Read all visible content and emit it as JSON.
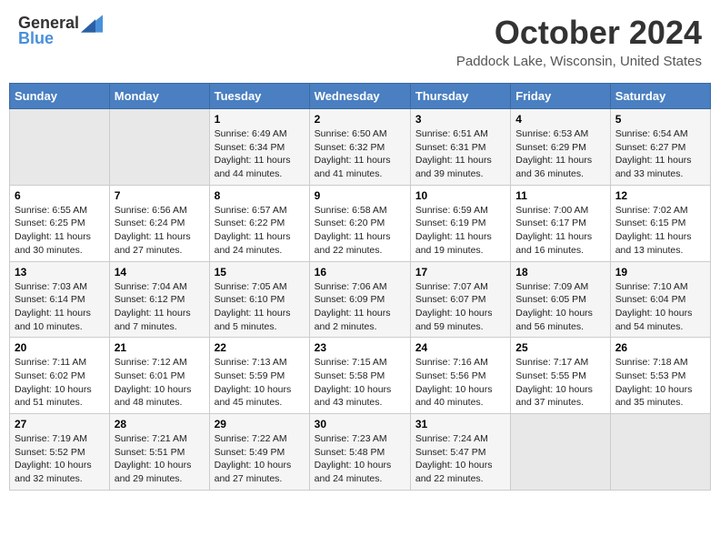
{
  "header": {
    "logo_general": "General",
    "logo_blue": "Blue",
    "month_title": "October 2024",
    "location": "Paddock Lake, Wisconsin, United States"
  },
  "days_of_week": [
    "Sunday",
    "Monday",
    "Tuesday",
    "Wednesday",
    "Thursday",
    "Friday",
    "Saturday"
  ],
  "weeks": [
    [
      {
        "day": "",
        "empty": true
      },
      {
        "day": "",
        "empty": true
      },
      {
        "day": "1",
        "sunrise": "6:49 AM",
        "sunset": "6:34 PM",
        "daylight": "11 hours and 44 minutes."
      },
      {
        "day": "2",
        "sunrise": "6:50 AM",
        "sunset": "6:32 PM",
        "daylight": "11 hours and 41 minutes."
      },
      {
        "day": "3",
        "sunrise": "6:51 AM",
        "sunset": "6:31 PM",
        "daylight": "11 hours and 39 minutes."
      },
      {
        "day": "4",
        "sunrise": "6:53 AM",
        "sunset": "6:29 PM",
        "daylight": "11 hours and 36 minutes."
      },
      {
        "day": "5",
        "sunrise": "6:54 AM",
        "sunset": "6:27 PM",
        "daylight": "11 hours and 33 minutes."
      }
    ],
    [
      {
        "day": "6",
        "sunrise": "6:55 AM",
        "sunset": "6:25 PM",
        "daylight": "11 hours and 30 minutes."
      },
      {
        "day": "7",
        "sunrise": "6:56 AM",
        "sunset": "6:24 PM",
        "daylight": "11 hours and 27 minutes."
      },
      {
        "day": "8",
        "sunrise": "6:57 AM",
        "sunset": "6:22 PM",
        "daylight": "11 hours and 24 minutes."
      },
      {
        "day": "9",
        "sunrise": "6:58 AM",
        "sunset": "6:20 PM",
        "daylight": "11 hours and 22 minutes."
      },
      {
        "day": "10",
        "sunrise": "6:59 AM",
        "sunset": "6:19 PM",
        "daylight": "11 hours and 19 minutes."
      },
      {
        "day": "11",
        "sunrise": "7:00 AM",
        "sunset": "6:17 PM",
        "daylight": "11 hours and 16 minutes."
      },
      {
        "day": "12",
        "sunrise": "7:02 AM",
        "sunset": "6:15 PM",
        "daylight": "11 hours and 13 minutes."
      }
    ],
    [
      {
        "day": "13",
        "sunrise": "7:03 AM",
        "sunset": "6:14 PM",
        "daylight": "11 hours and 10 minutes."
      },
      {
        "day": "14",
        "sunrise": "7:04 AM",
        "sunset": "6:12 PM",
        "daylight": "11 hours and 7 minutes."
      },
      {
        "day": "15",
        "sunrise": "7:05 AM",
        "sunset": "6:10 PM",
        "daylight": "11 hours and 5 minutes."
      },
      {
        "day": "16",
        "sunrise": "7:06 AM",
        "sunset": "6:09 PM",
        "daylight": "11 hours and 2 minutes."
      },
      {
        "day": "17",
        "sunrise": "7:07 AM",
        "sunset": "6:07 PM",
        "daylight": "10 hours and 59 minutes."
      },
      {
        "day": "18",
        "sunrise": "7:09 AM",
        "sunset": "6:05 PM",
        "daylight": "10 hours and 56 minutes."
      },
      {
        "day": "19",
        "sunrise": "7:10 AM",
        "sunset": "6:04 PM",
        "daylight": "10 hours and 54 minutes."
      }
    ],
    [
      {
        "day": "20",
        "sunrise": "7:11 AM",
        "sunset": "6:02 PM",
        "daylight": "10 hours and 51 minutes."
      },
      {
        "day": "21",
        "sunrise": "7:12 AM",
        "sunset": "6:01 PM",
        "daylight": "10 hours and 48 minutes."
      },
      {
        "day": "22",
        "sunrise": "7:13 AM",
        "sunset": "5:59 PM",
        "daylight": "10 hours and 45 minutes."
      },
      {
        "day": "23",
        "sunrise": "7:15 AM",
        "sunset": "5:58 PM",
        "daylight": "10 hours and 43 minutes."
      },
      {
        "day": "24",
        "sunrise": "7:16 AM",
        "sunset": "5:56 PM",
        "daylight": "10 hours and 40 minutes."
      },
      {
        "day": "25",
        "sunrise": "7:17 AM",
        "sunset": "5:55 PM",
        "daylight": "10 hours and 37 minutes."
      },
      {
        "day": "26",
        "sunrise": "7:18 AM",
        "sunset": "5:53 PM",
        "daylight": "10 hours and 35 minutes."
      }
    ],
    [
      {
        "day": "27",
        "sunrise": "7:19 AM",
        "sunset": "5:52 PM",
        "daylight": "10 hours and 32 minutes."
      },
      {
        "day": "28",
        "sunrise": "7:21 AM",
        "sunset": "5:51 PM",
        "daylight": "10 hours and 29 minutes."
      },
      {
        "day": "29",
        "sunrise": "7:22 AM",
        "sunset": "5:49 PM",
        "daylight": "10 hours and 27 minutes."
      },
      {
        "day": "30",
        "sunrise": "7:23 AM",
        "sunset": "5:48 PM",
        "daylight": "10 hours and 24 minutes."
      },
      {
        "day": "31",
        "sunrise": "7:24 AM",
        "sunset": "5:47 PM",
        "daylight": "10 hours and 22 minutes."
      },
      {
        "day": "",
        "empty": true
      },
      {
        "day": "",
        "empty": true
      }
    ]
  ]
}
